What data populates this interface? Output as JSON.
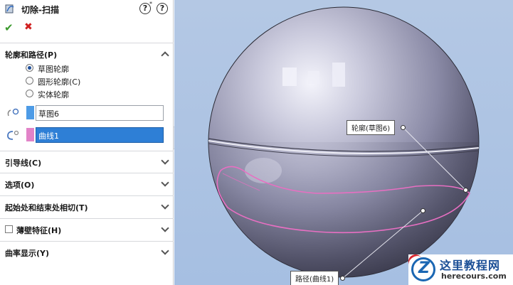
{
  "panel": {
    "title": "切除-扫描",
    "help_symbol": "?",
    "help_star": "*",
    "ok_symbol": "✔",
    "cancel_symbol": "✖"
  },
  "profile_path": {
    "header": "轮廓和路径(P)",
    "options": [
      {
        "label": "草图轮廓",
        "selected": true
      },
      {
        "label": "圆形轮廓(C)",
        "selected": false
      },
      {
        "label": "实体轮廓",
        "selected": false
      }
    ],
    "profile_value": "草图6",
    "profile_color": "#4d9be6",
    "path_value": "曲线1",
    "path_color": "#e283c8"
  },
  "sections": {
    "guide_curves": "引导线(C)",
    "options": "选项(O)",
    "start_end_tangency": "起始处和结束处相切(T)",
    "thin_feature": "薄壁特征(H)",
    "curvature_display": "曲率显示(Y)"
  },
  "viewport": {
    "callout_profile": "轮廓(草图6)",
    "callout_path": "路径(曲线1)",
    "background_color": "#a6bfe2",
    "curve_color": "#e86fc2"
  },
  "watermark": {
    "cn_text": "这里教程网",
    "en_text": "herecours.com"
  }
}
